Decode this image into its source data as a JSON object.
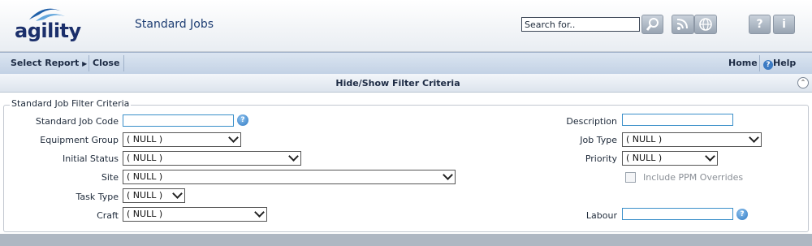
{
  "header": {
    "logo_text": "agility",
    "page_title": "Standard Jobs",
    "search_value": "Search for..",
    "icons": [
      "search-icon",
      "rss-icon",
      "globe-icon",
      "help-question-icon",
      "info-icon"
    ]
  },
  "nav": {
    "select_report": "Select Report",
    "close": "Close",
    "home": "Home",
    "help": "Help"
  },
  "filter_bar": {
    "label": "Hide/Show Filter Criteria"
  },
  "filter": {
    "legend": "Standard Job Filter Criteria",
    "standard_job_code": {
      "label": "Standard Job Code",
      "value": ""
    },
    "equipment_group": {
      "label": "Equipment Group",
      "value": "( NULL )"
    },
    "initial_status": {
      "label": "Initial Status",
      "value": "( NULL )"
    },
    "site": {
      "label": "Site",
      "value": "( NULL )"
    },
    "task_type": {
      "label": "Task Type",
      "value": "( NULL )"
    },
    "craft": {
      "label": "Craft",
      "value": "( NULL )"
    },
    "description": {
      "label": "Description",
      "value": ""
    },
    "job_type": {
      "label": "Job Type",
      "value": "( NULL )"
    },
    "priority": {
      "label": "Priority",
      "value": "( NULL )"
    },
    "include_ppm": {
      "label": "Include PPM Overrides",
      "checked": false
    },
    "labour": {
      "label": "Labour",
      "value": ""
    }
  },
  "colors": {
    "accent": "#3c7bc4",
    "nav_bg": "#c3d2e5",
    "page_bg": "#aeb7c2"
  }
}
